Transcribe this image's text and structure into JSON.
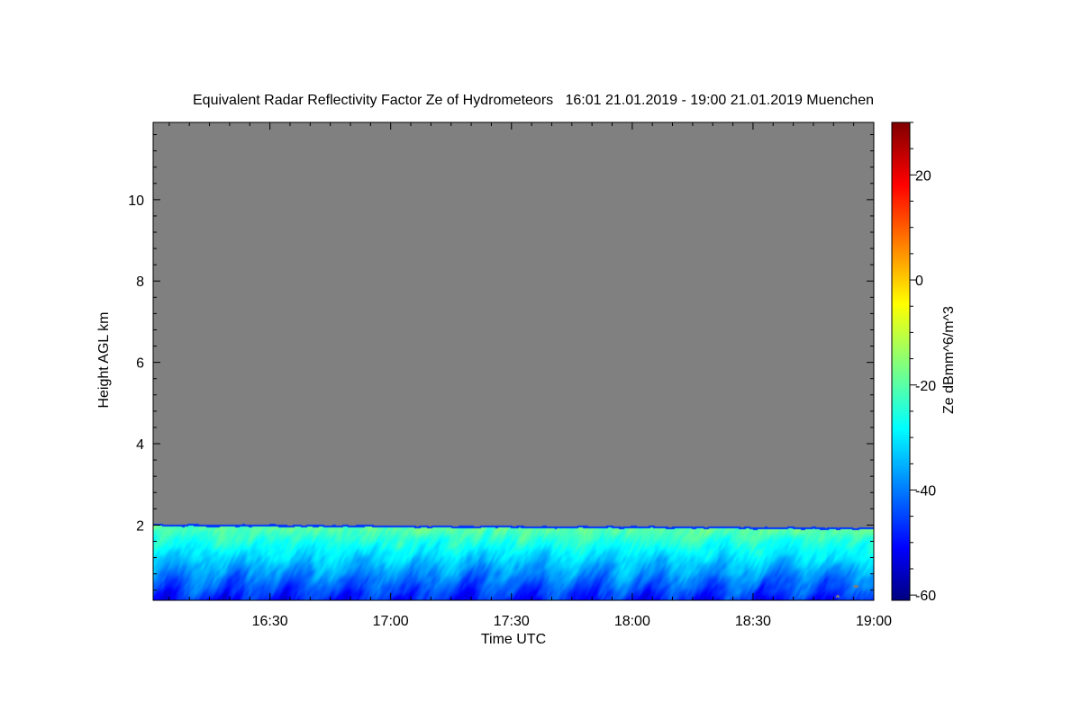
{
  "chart_data": {
    "type": "heatmap",
    "title": "Equivalent Radar Reflectivity Factor Ze of Hydrometeors   16:01 21.01.2019 - 19:00 21.01.2019 Muenchen",
    "xlabel": "Time UTC",
    "ylabel": "Height AGL km",
    "colorbar_label": "Ze dBmm^6/m^3",
    "x_range": [
      "16:01",
      "19:00"
    ],
    "x_ticks": [
      "16:30",
      "17:00",
      "17:30",
      "18:00",
      "18:30",
      "19:00"
    ],
    "y_range": [
      0.15,
      11.9
    ],
    "y_ticks": [
      2,
      4,
      6,
      8,
      10
    ],
    "y_tick_labels": [
      "2",
      "4",
      "6",
      "8",
      "10"
    ],
    "colorbar_range": [
      -61,
      30
    ],
    "colorbar_ticks": [
      -60,
      -40,
      -20,
      0,
      20
    ],
    "colorbar_tick_labels": [
      "-60",
      "-40",
      "-20",
      "0",
      "20"
    ],
    "background_color": "#808080",
    "echo_top_km": 2.05,
    "echo_features": [
      {
        "layer": "1.0-2.05 km",
        "ze_dbz_approx": -10
      },
      {
        "layer": "0.15-1.0 km",
        "ze_dbz_approx": -40
      }
    ]
  }
}
